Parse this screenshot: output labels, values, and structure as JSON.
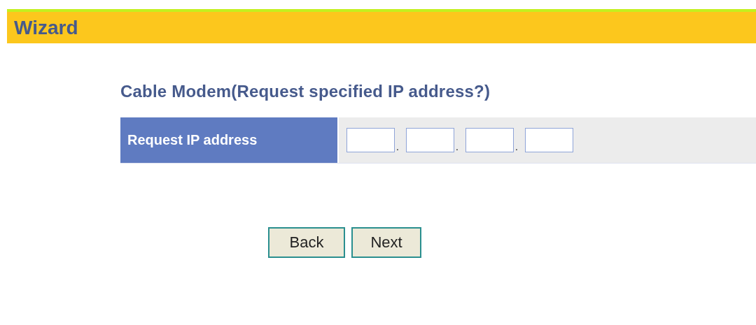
{
  "header": {
    "title": "Wizard"
  },
  "heading": "Cable Modem(Request specified IP address?)",
  "form": {
    "label": "Request IP address",
    "ip_fields": [
      {
        "kind": "input"
      },
      {
        "kind": "input"
      },
      {
        "kind": "input"
      },
      {
        "kind": "input"
      }
    ],
    "separators": [
      ".",
      ".",
      "."
    ]
  },
  "buttons": [
    "Back",
    "Next"
  ]
}
